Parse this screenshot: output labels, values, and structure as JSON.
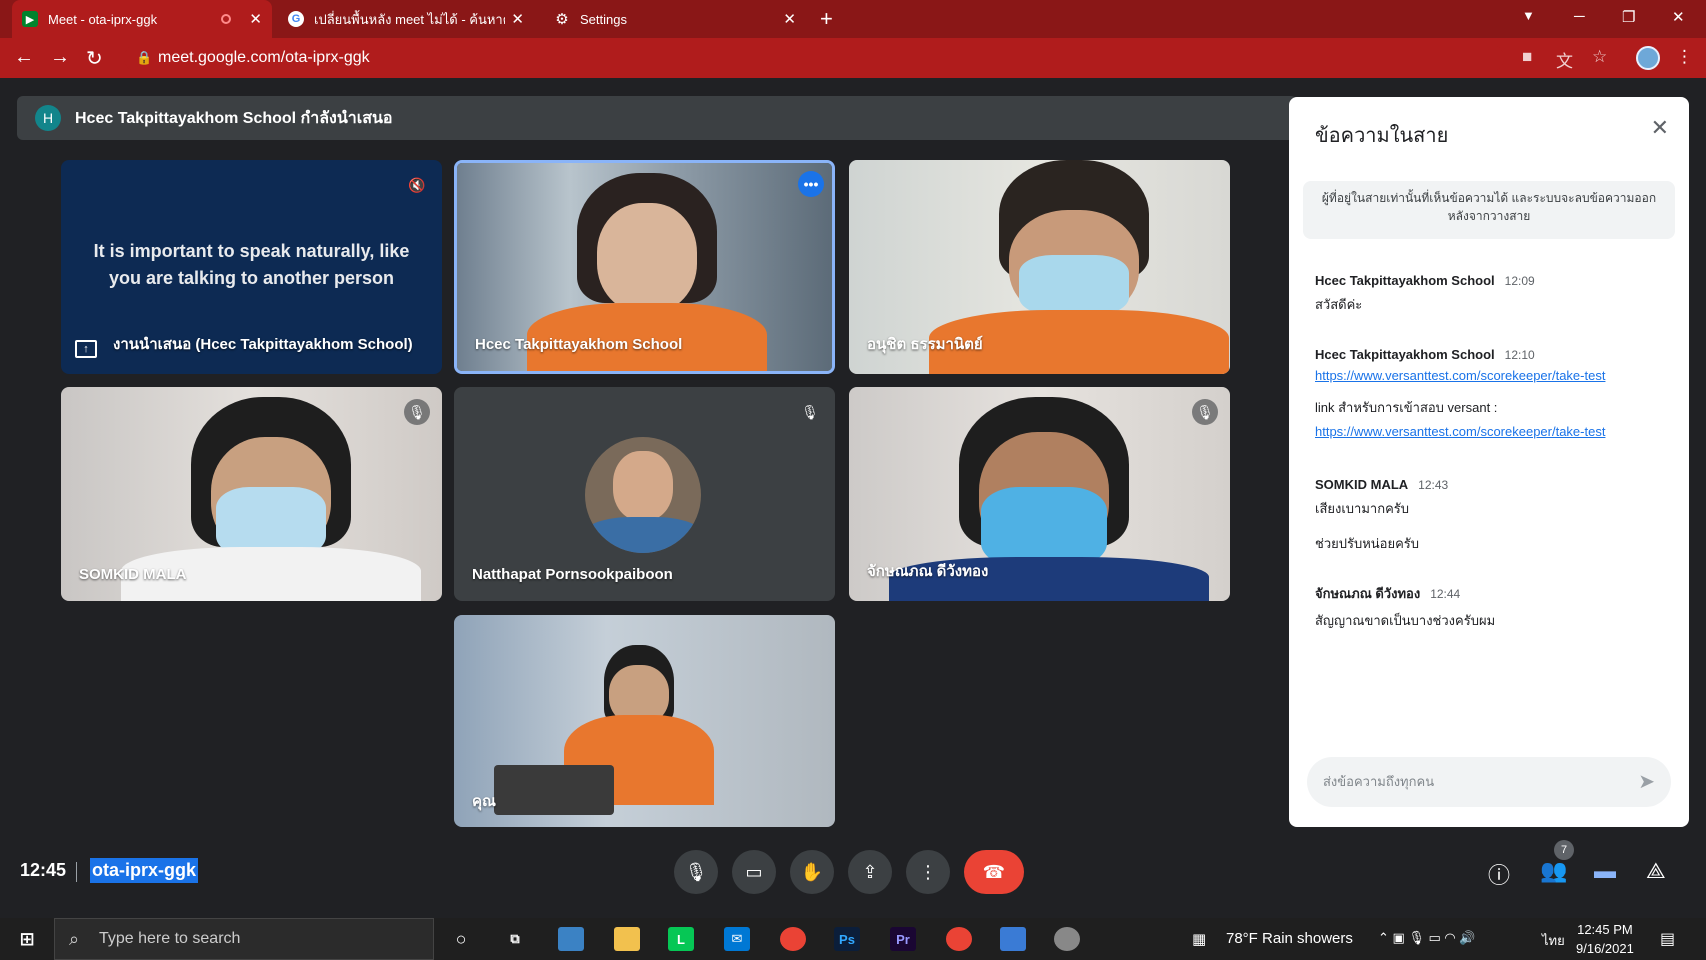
{
  "browser": {
    "tabs": [
      {
        "title": "Meet - ota-iprx-ggk",
        "recording": true
      },
      {
        "title": "เปลี่ยนพื้นหลัง meet ไม่ได้ - ค้นหาด้วย"
      },
      {
        "title": "Settings"
      }
    ],
    "url": "meet.google.com/ota-iprx-ggk"
  },
  "meet": {
    "presenting_banner": "Hcec Takpittayakhom School กำลังนำเสนอ",
    "presenter_initial": "H",
    "tiles": [
      {
        "name": "งานนำเสนอ (Hcec Takpittayakhom School)",
        "caption": "It is important to speak naturally, like you are talking to another person"
      },
      {
        "name": "Hcec Takpittayakhom School"
      },
      {
        "name": "อนุชิต ธรรมานิตย์"
      },
      {
        "name": "SOMKID MALA"
      },
      {
        "name": "Natthapat Pornsookpaiboon"
      },
      {
        "name": "จักษณภณ ดีวังทอง"
      },
      {
        "name": "คุณ"
      }
    ],
    "time": "12:45",
    "meeting_code": "ota-iprx-ggk",
    "people_count": "7"
  },
  "chat": {
    "title": "ข้อความในสาย",
    "notice": "ผู้ที่อยู่ในสายเท่านั้นที่เห็นข้อความได้ และระบบจะลบข้อความออกหลังจากวางสาย",
    "messages": [
      {
        "sender": "Hcec Takpittayakhom School",
        "time": "12:09",
        "lines": [
          "สวัสดีค่ะ"
        ]
      },
      {
        "sender": "Hcec Takpittayakhom School",
        "time": "12:10",
        "link1": "https://www.versanttest.com/scorekeeper/take-test",
        "text2": "link สำหรับการเข้าสอบ versant :",
        "link2": "https://www.versanttest.com/scorekeeper/take-test"
      },
      {
        "sender": "SOMKID MALA",
        "time": "12:43",
        "lines": [
          "เสียงเบามากครับ",
          "ช่วยปรับหน่อยครับ"
        ]
      },
      {
        "sender": "จักษณภณ ดีวังทอง",
        "time": "12:44",
        "lines": [
          "สัญญาณขาดเป็นบางช่วงครับผม"
        ]
      }
    ],
    "input_placeholder": "ส่งข้อความถึงทุกคน"
  },
  "taskbar": {
    "search_placeholder": "Type here to search",
    "weather": "78°F  Rain showers",
    "language": "ไทย",
    "clock_time": "12:45 PM",
    "clock_date": "9/16/2021"
  },
  "colors": {
    "tabbar": "#8a1717",
    "accent": "#1a73e8",
    "end_call": "#ea4335"
  }
}
